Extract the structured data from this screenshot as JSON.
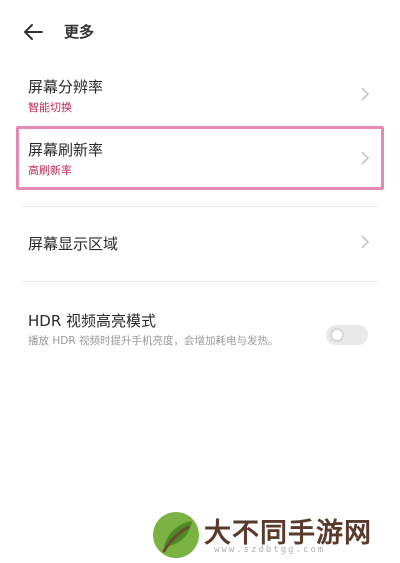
{
  "header": {
    "title": "更多",
    "back_icon": "arrow-left-icon"
  },
  "settings": [
    {
      "title": "屏幕分辨率",
      "subtitle": "智能切换"
    },
    {
      "title": "屏幕刷新率",
      "subtitle": "高刷新率"
    },
    {
      "title": "屏幕显示区域",
      "subtitle": ""
    }
  ],
  "hdr": {
    "title": "HDR 视频高亮模式",
    "description": "播放 HDR 视频时提升手机亮度，会增加耗电与发热。",
    "enabled": false
  },
  "watermark": {
    "text": "大不同手游网",
    "url": "www.szdbtgg.com"
  },
  "colors": {
    "accent_text": "#c22a55",
    "highlight_border": "#e58ab5"
  }
}
